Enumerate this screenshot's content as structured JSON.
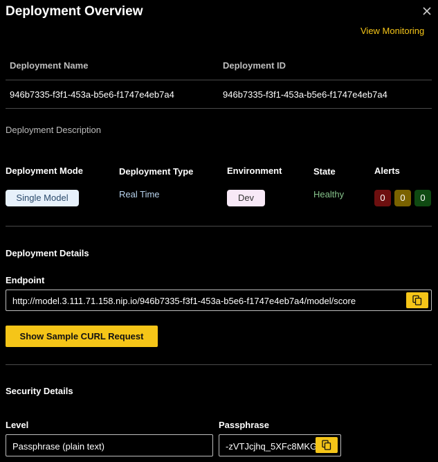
{
  "header": {
    "title": "Deployment Overview",
    "view_monitoring": "View Monitoring",
    "close_icon": "close-icon"
  },
  "table": {
    "headers": [
      "Deployment Name",
      "Deployment ID"
    ],
    "row": [
      "946b7335-f3f1-453a-b5e6-f1747e4eb7a4",
      "946b7335-f3f1-453a-b5e6-f1747e4eb7a4"
    ]
  },
  "description": {
    "label": "Deployment Description"
  },
  "attributes": {
    "mode_label": "Deployment Mode",
    "mode_value": "Single Model",
    "type_label": "Deployment Type",
    "type_value": "Real Time",
    "env_label": "Environment",
    "env_value": "Dev",
    "state_label": "State",
    "state_value": "Healthy",
    "alerts_label": "Alerts",
    "alerts": [
      {
        "count": "0",
        "color": "#6d0f0f"
      },
      {
        "count": "0",
        "color": "#7a6200"
      },
      {
        "count": "0",
        "color": "#0f4a12"
      }
    ]
  },
  "details": {
    "title": "Deployment Details",
    "endpoint_label": "Endpoint",
    "endpoint_value": "http://model.3.111.71.158.nip.io/946b7335-f3f1-453a-b5e6-f1747e4eb7a4/model/score",
    "copy_icon": "copy-icon",
    "curl_button": "Show Sample CURL Request"
  },
  "security": {
    "title": "Security Details",
    "level_label": "Level",
    "level_value": "Passphrase (plain text)",
    "passphrase_label": "Passphrase",
    "passphrase_value": "-zVTJcjhq_5XFc8MKG"
  },
  "colors": {
    "accent": "#f5c518",
    "background": "#000000"
  }
}
